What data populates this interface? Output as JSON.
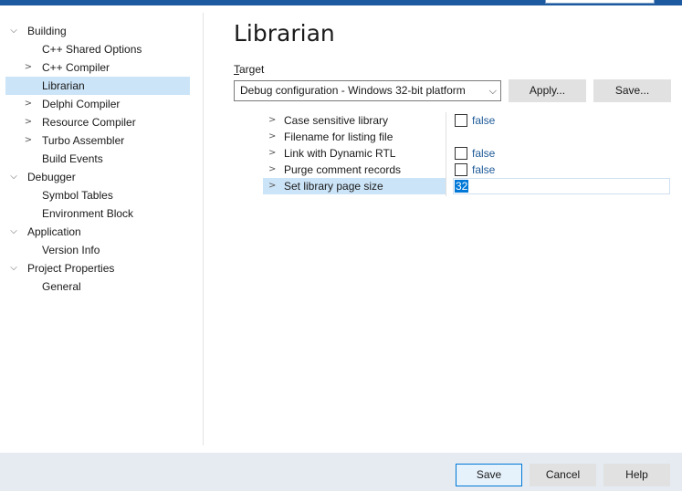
{
  "tree": [
    {
      "label": "Building",
      "expanded": true,
      "chevron": "⌵"
    },
    {
      "label": "C++ Shared Options",
      "chevron": ""
    },
    {
      "label": "C++ Compiler",
      "chevron": ">"
    },
    {
      "label": "Librarian",
      "chevron": "",
      "selected": true
    },
    {
      "label": "Delphi Compiler",
      "chevron": ">"
    },
    {
      "label": "Resource Compiler",
      "chevron": ">"
    },
    {
      "label": "Turbo Assembler",
      "chevron": ">"
    },
    {
      "label": "Build Events",
      "chevron": ""
    },
    {
      "label": "Debugger",
      "expanded": true,
      "chevron": "⌵"
    },
    {
      "label": "Symbol Tables",
      "chevron": ""
    },
    {
      "label": "Environment Block",
      "chevron": ""
    },
    {
      "label": "Application",
      "expanded": true,
      "chevron": "⌵"
    },
    {
      "label": "Version Info",
      "chevron": ""
    },
    {
      "label": "Project Properties",
      "expanded": true,
      "chevron": "⌵"
    },
    {
      "label": "General",
      "chevron": ""
    }
  ],
  "page": {
    "title": "Librarian",
    "target_label_accel": "T",
    "target_label_rest": "arget",
    "target_value": "Debug configuration - Windows 32-bit platform",
    "apply_label": "Apply...",
    "save_label": "Save..."
  },
  "properties": [
    {
      "name": "Case sensitive library",
      "value": "false",
      "checkbox": true
    },
    {
      "name": "Filename for listing file",
      "value": "",
      "checkbox": false
    },
    {
      "name": "Link with Dynamic RTL",
      "value": "false",
      "checkbox": true
    },
    {
      "name": "Purge comment records",
      "value": "false",
      "checkbox": true
    },
    {
      "name": "Set library page size",
      "value": "32",
      "checkbox": false,
      "selected": true,
      "editing": true
    }
  ],
  "footer": {
    "save": "Save",
    "cancel": "Cancel",
    "help": "Help"
  },
  "colors": {
    "accent": "#0078d7",
    "selection": "#cce4f7",
    "value_text": "#1f5b99"
  }
}
